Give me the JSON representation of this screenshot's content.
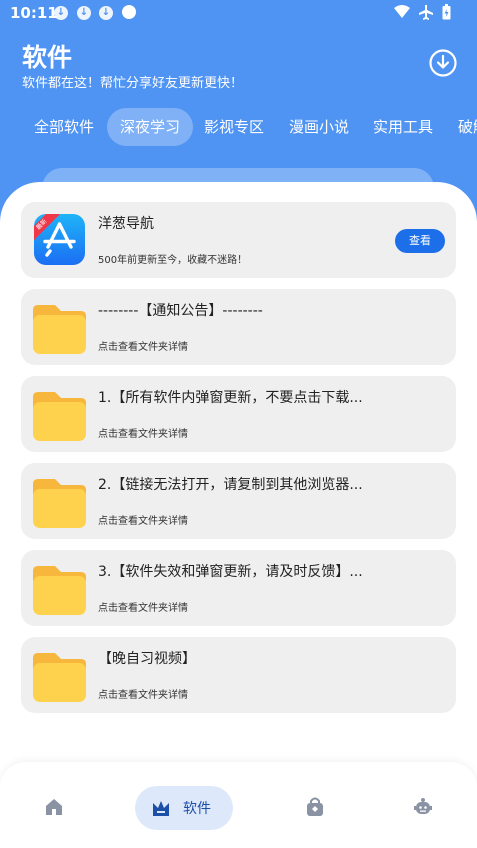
{
  "status": {
    "time": "10:11"
  },
  "header": {
    "title": "软件",
    "subtitle": "软件都在这！帮忙分享好友更新更快！"
  },
  "tabs": [
    {
      "label": "全部软件",
      "active": false
    },
    {
      "label": "深夜学习",
      "active": true
    },
    {
      "label": "影视专区",
      "active": false
    },
    {
      "label": "漫画小说",
      "active": false
    },
    {
      "label": "实用工具",
      "active": false
    },
    {
      "label": "破解",
      "active": false
    }
  ],
  "featured": {
    "title": "洋葱导航",
    "subtitle": "500年前更新至今，收藏不迷路！",
    "button": "查看",
    "ribbon": "最新"
  },
  "folders": [
    {
      "title": "--------【通知公告】--------",
      "subtitle": "点击查看文件夹详情"
    },
    {
      "title": "1.【所有软件内弹窗更新，不要点击下载...",
      "subtitle": "点击查看文件夹详情"
    },
    {
      "title": "2.【链接无法打开，请复制到其他浏览器...",
      "subtitle": "点击查看文件夹详情"
    },
    {
      "title": "3.【软件失效和弹窗更新，请及时反馈】...",
      "subtitle": "点击查看文件夹详情"
    },
    {
      "title": "【晚自习视频】",
      "subtitle": "点击查看文件夹详情"
    }
  ],
  "bottom_nav": {
    "active_label": "软件",
    "items": [
      "home-icon",
      "crown-icon",
      "bag-icon",
      "robot-icon"
    ]
  },
  "colors": {
    "primary": "#4f93f3",
    "button": "#1c6fe8",
    "folder": "#ffd24d",
    "card": "#efefef",
    "nav_active": "#dde9fb"
  }
}
